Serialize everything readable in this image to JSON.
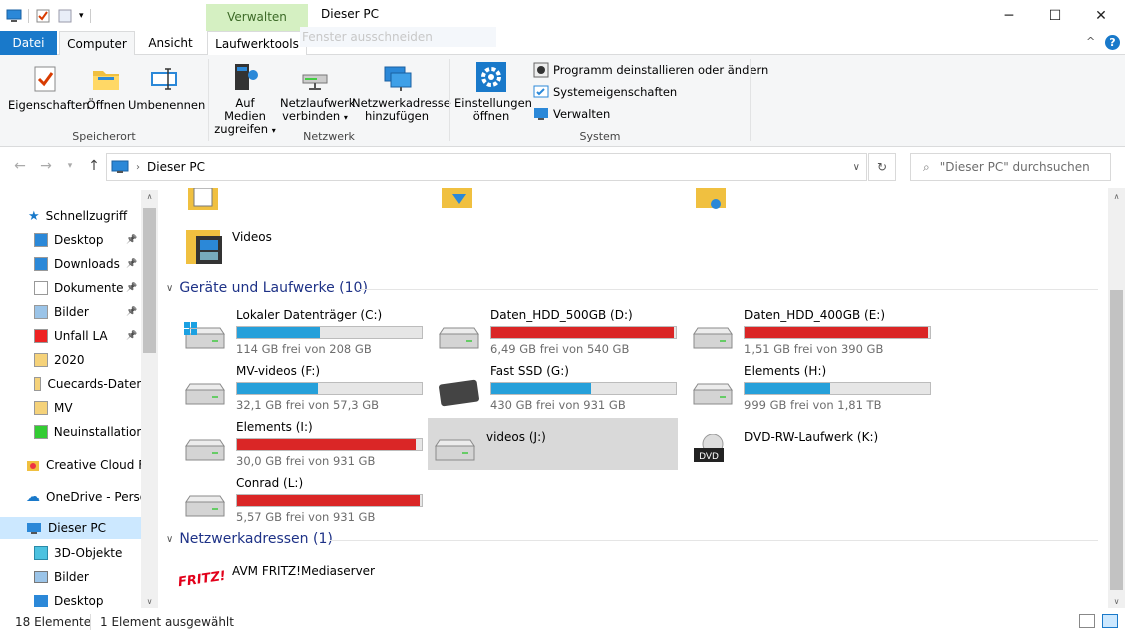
{
  "window": {
    "title": "Dieser PC",
    "context_tab_header": "Verwalten",
    "min_icon": "─",
    "max_icon": "☐",
    "close_icon": "✕",
    "faded_hint": "Fenster ausschneiden"
  },
  "tabs": {
    "file": "Datei",
    "computer": "Computer",
    "view": "Ansicht",
    "drivetools": "Laufwerktools"
  },
  "ribbon": {
    "location": {
      "properties": "Eigenschaften",
      "open": "Öffnen",
      "rename": "Umbenennen",
      "label": "Speicherort"
    },
    "network": {
      "access_media_1": "Auf Medien",
      "access_media_2": "zugreifen",
      "map_drive_1": "Netzlaufwerk",
      "map_drive_2": "verbinden",
      "add_location_1": "Netzwerkadresse",
      "add_location_2": "hinzufügen",
      "label": "Netzwerk"
    },
    "system": {
      "settings_1": "Einstellungen",
      "settings_2": "öffnen",
      "uninstall": "Programm deinstallieren oder ändern",
      "sysprops": "Systemeigenschaften",
      "manage": "Verwalten",
      "label": "System"
    }
  },
  "address": {
    "path": "Dieser PC",
    "search_placeholder": "\"Dieser PC\" durchsuchen"
  },
  "nav": {
    "quick_access": "Schnellzugriff",
    "items": [
      {
        "label": "Desktop",
        "pinned": true
      },
      {
        "label": "Downloads",
        "pinned": true
      },
      {
        "label": "Dokumente",
        "pinned": true
      },
      {
        "label": "Bilder",
        "pinned": true
      },
      {
        "label": "Unfall LA",
        "pinned": true
      },
      {
        "label": "2020",
        "pinned": false
      },
      {
        "label": "Cuecards-Daten",
        "pinned": false
      },
      {
        "label": "MV",
        "pinned": false
      },
      {
        "label": "Neuinstallation",
        "pinned": false
      }
    ],
    "creative_cloud": "Creative Cloud Fil",
    "onedrive": "OneDrive - Persor",
    "this_pc": "Dieser PC",
    "pc_items": [
      "3D-Objekte",
      "Bilder",
      "Desktop"
    ]
  },
  "content": {
    "videos_folder": "Videos",
    "devices_header": "Geräte und Laufwerke (10)",
    "drives": [
      {
        "name": "Lokaler Datenträger (C:)",
        "free": "114 GB frei von 208 GB",
        "used_fraction": 0.45,
        "color": "#26a0da"
      },
      {
        "name": "Daten_HDD_500GB (D:)",
        "free": "6,49 GB frei von 540 GB",
        "used_fraction": 0.99,
        "color": "#da2626"
      },
      {
        "name": "Daten_HDD_400GB (E:)",
        "free": "1,51 GB frei von 390 GB",
        "used_fraction": 0.99,
        "color": "#da2626"
      },
      {
        "name": "MV-videos (F:)",
        "free": "32,1 GB frei von 57,3 GB",
        "used_fraction": 0.44,
        "color": "#26a0da"
      },
      {
        "name": "Fast SSD (G:)",
        "free": "430 GB frei von 931 GB",
        "used_fraction": 0.54,
        "color": "#26a0da"
      },
      {
        "name": "Elements (H:)",
        "free": "999 GB frei von 1,81 TB",
        "used_fraction": 0.46,
        "color": "#26a0da"
      },
      {
        "name": "Elements (I:)",
        "free": "30,0 GB frei von 931 GB",
        "used_fraction": 0.97,
        "color": "#da2626"
      },
      {
        "name": "videos (J:)",
        "free": "",
        "used_fraction": 0,
        "color": "#26a0da"
      },
      {
        "name": "DVD-RW-Laufwerk (K:)",
        "free": "",
        "used_fraction": 0,
        "color": "#26a0da"
      },
      {
        "name": "Conrad (L:)",
        "free": "5,57 GB frei von 931 GB",
        "used_fraction": 0.99,
        "color": "#da2626"
      }
    ],
    "network_header": "Netzwerkadressen (1)",
    "network_items": [
      "AVM FRITZ!Mediaserver"
    ],
    "dvd_label": "DVD",
    "fritz_label": "FRITZ!"
  },
  "status": {
    "count": "18 Elemente",
    "selection": "1 Element ausgewählt"
  }
}
